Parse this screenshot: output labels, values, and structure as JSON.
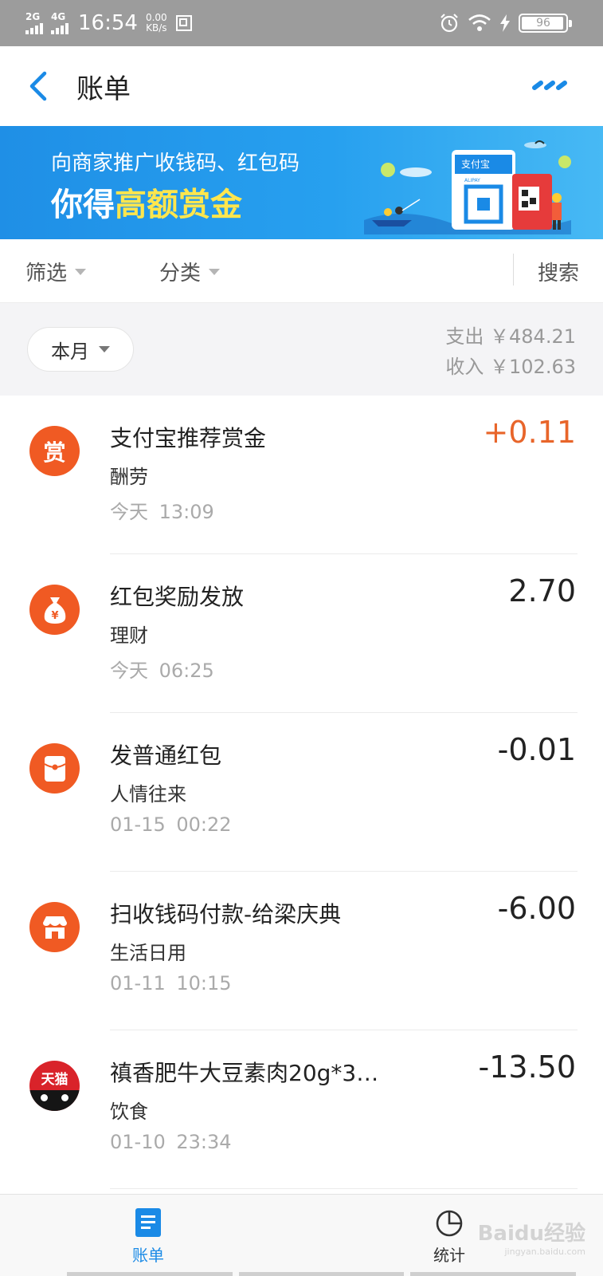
{
  "status_bar": {
    "net1": "2G",
    "net2": "4G",
    "time": "16:54",
    "speed_value": "0.00",
    "speed_unit": "KB/s",
    "battery": "96"
  },
  "header": {
    "title": "账单"
  },
  "banner": {
    "line1": "向商家推广收钱码、红包码",
    "line2_prefix": "你得",
    "line2_highlight": "高额赏金",
    "brand": "支付宝",
    "brand_en": "ALIPAY"
  },
  "filters": {
    "filter_label": "筛选",
    "category_label": "分类",
    "search_label": "搜索"
  },
  "summary": {
    "month_label": "本月",
    "expense": "支出 ￥484.21",
    "income": "收入 ￥102.63"
  },
  "transactions": [
    {
      "icon": "赏",
      "name": "支付宝推荐赏金",
      "category": "酬劳",
      "date": "今天 13:09",
      "amount": "+0.11"
    },
    {
      "icon": "money-bag-icon",
      "name": "红包奖励发放",
      "category": "理财",
      "date": "今天 06:25",
      "amount": "2.70"
    },
    {
      "icon": "red-packet-icon",
      "name": "发普通红包",
      "category": "人情往来",
      "date": "01-15 00:22",
      "amount": "-0.01"
    },
    {
      "icon": "shop-icon",
      "name": "扫收钱码付款-给梁庆典",
      "category": "生活日用",
      "date": "01-11 10:15",
      "amount": "-6.00"
    },
    {
      "icon": "天猫",
      "name": "禛香肥牛大豆素肉20g*3…",
      "category": "饮食",
      "date": "01-10 23:34",
      "amount": "-13.50"
    }
  ],
  "tab_bar": {
    "bill_label": "账单",
    "stats_label": "统计"
  },
  "watermark": {
    "text": "Baidu经验",
    "sub": "jingyan.baidu.com"
  },
  "colors": {
    "accent": "#1a8ae6",
    "income": "#e8652a",
    "icon_bg": "#f05a23",
    "tmall": "#d9232a"
  }
}
